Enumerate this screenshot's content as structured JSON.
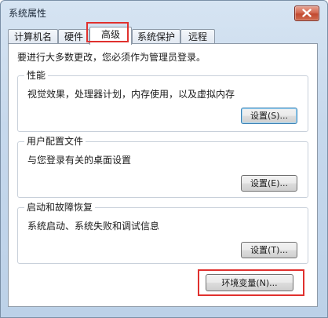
{
  "window": {
    "title": "系统属性",
    "close_icon": "close-icon"
  },
  "tabs": [
    {
      "label": "计算机名"
    },
    {
      "label": "硬件"
    },
    {
      "label": "高级",
      "active": true
    },
    {
      "label": "系统保护"
    },
    {
      "label": "远程"
    }
  ],
  "notice": "要进行大多数更改，您必须作为管理员登录。",
  "performance": {
    "title": "性能",
    "description": "视觉效果，处理器计划，内存使用，以及虚拟内存",
    "button": "设置(S)..."
  },
  "user_profiles": {
    "title": "用户配置文件",
    "description": "与您登录有关的桌面设置",
    "button": "设置(E)..."
  },
  "startup_recovery": {
    "title": "启动和故障恢复",
    "description": "系统启动、系统失败和调试信息",
    "button": "设置(T)..."
  },
  "env_vars": {
    "button": "环境变量(N)..."
  },
  "colors": {
    "highlight": "#e0312e"
  }
}
